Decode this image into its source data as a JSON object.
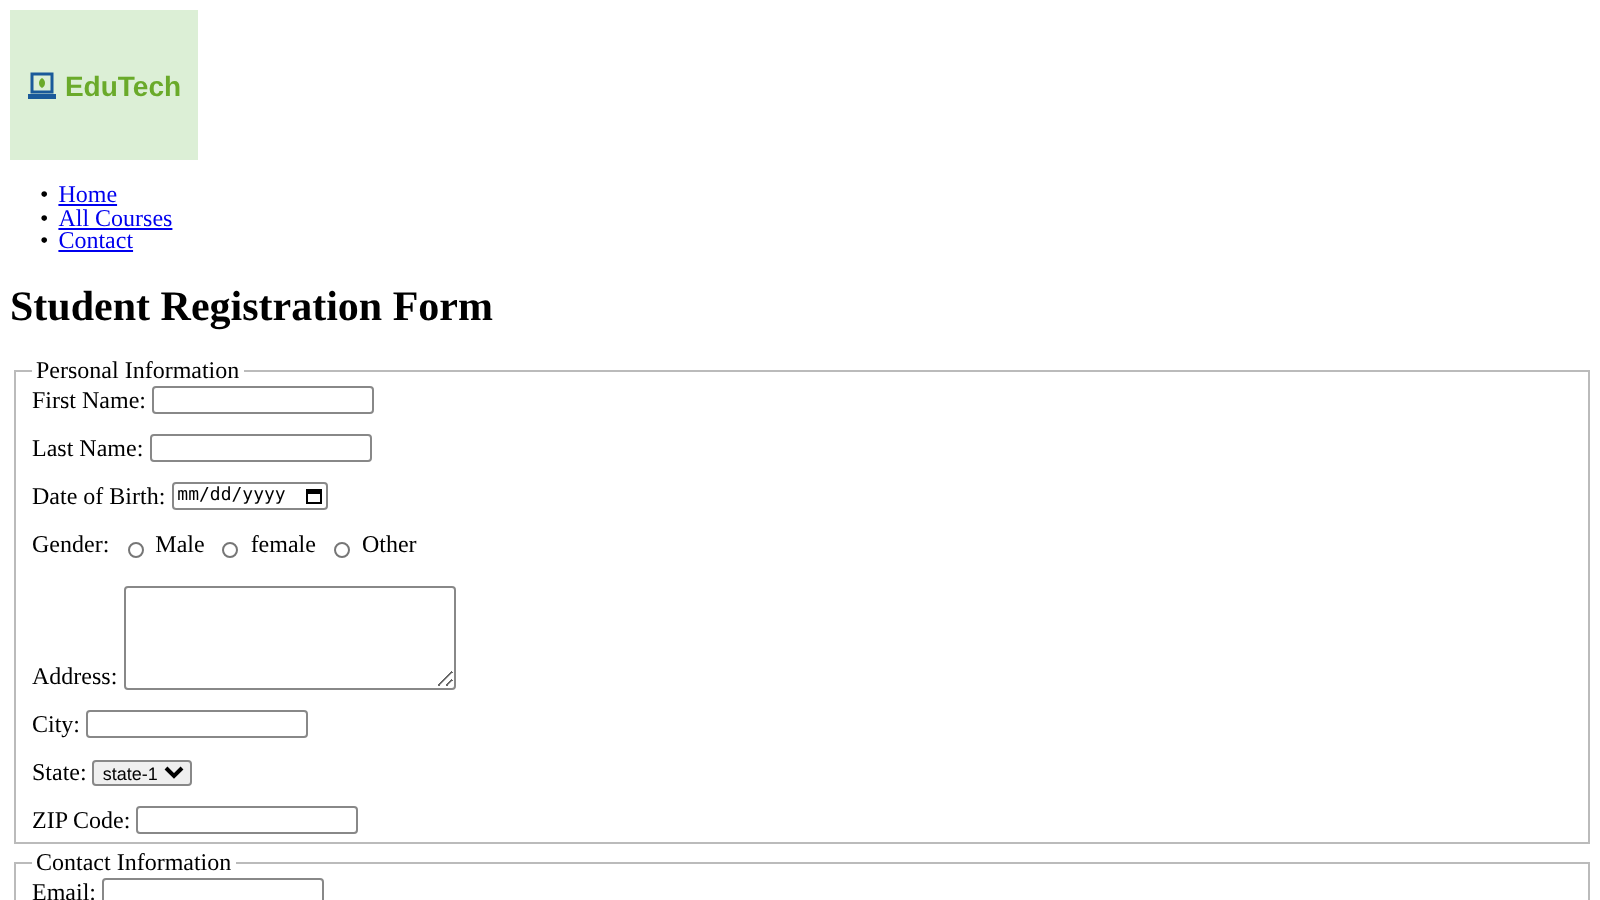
{
  "logo": {
    "text": "EduTech"
  },
  "nav": [
    {
      "marker": "•",
      "label": "Home"
    },
    {
      "marker": "•",
      "label": "All Courses"
    },
    {
      "marker": "•",
      "label": "Contact"
    }
  ],
  "title": "Student Registration Form",
  "sections": [
    {
      "legend": "Personal Information",
      "fields": [
        {
          "kind": "text",
          "label": "First Name:"
        },
        {
          "kind": "text",
          "label": "Last Name:"
        },
        {
          "kind": "date",
          "label": "Date of Birth:",
          "placeholder": "mm/dd/yyyy"
        },
        {
          "kind": "radio",
          "label": "Gender:",
          "options": [
            {
              "label": "Male",
              "selected": false
            },
            {
              "label": "female",
              "selected": false
            },
            {
              "label": "Other",
              "selected": false
            }
          ]
        },
        {
          "kind": "textarea",
          "label": "Address:"
        },
        {
          "kind": "text",
          "label": "City:"
        },
        {
          "kind": "select",
          "label": "State:",
          "value": "state-1"
        },
        {
          "kind": "text",
          "label": "ZIP Code:"
        }
      ]
    },
    {
      "legend": "Contact Information",
      "fields": [
        {
          "kind": "text",
          "label": "Email:"
        }
      ]
    }
  ]
}
